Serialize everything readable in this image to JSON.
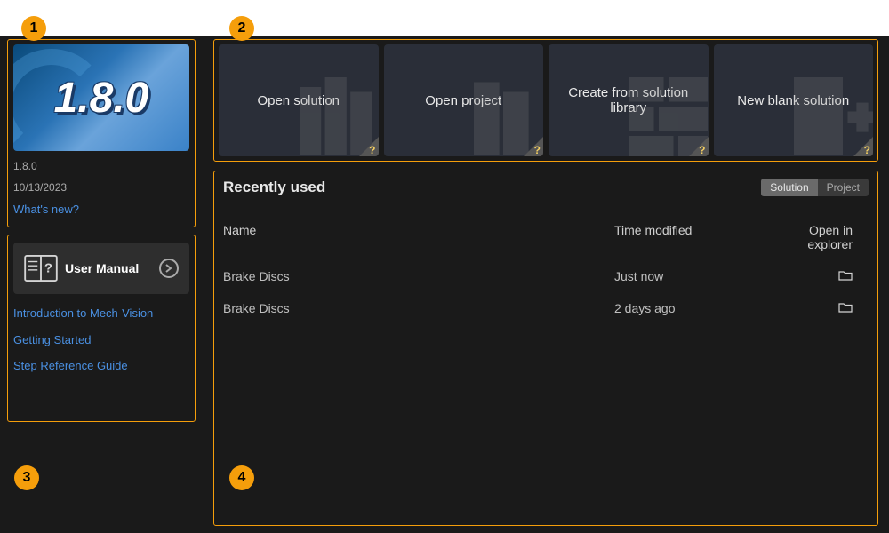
{
  "version": {
    "banner_text": "1.8.0",
    "number": "1.8.0",
    "date": "10/13/2023",
    "whatsnew": "What's new?"
  },
  "manual": {
    "title": "User Manual",
    "links": [
      "Introduction to Mech-Vision",
      "Getting Started",
      "Step Reference Guide"
    ]
  },
  "actions": [
    {
      "label": "Open solution"
    },
    {
      "label": "Open project"
    },
    {
      "label": "Create from solution library"
    },
    {
      "label": "New blank solution"
    }
  ],
  "recent": {
    "title": "Recently used",
    "tabs": {
      "solution": "Solution",
      "project": "Project"
    },
    "headers": {
      "name": "Name",
      "time": "Time modified",
      "open": "Open in explorer"
    },
    "rows": [
      {
        "name": "Brake Discs",
        "time": "Just now"
      },
      {
        "name": "Brake Discs",
        "time": "2 days ago"
      }
    ]
  },
  "badges": [
    "1",
    "2",
    "3",
    "4"
  ]
}
